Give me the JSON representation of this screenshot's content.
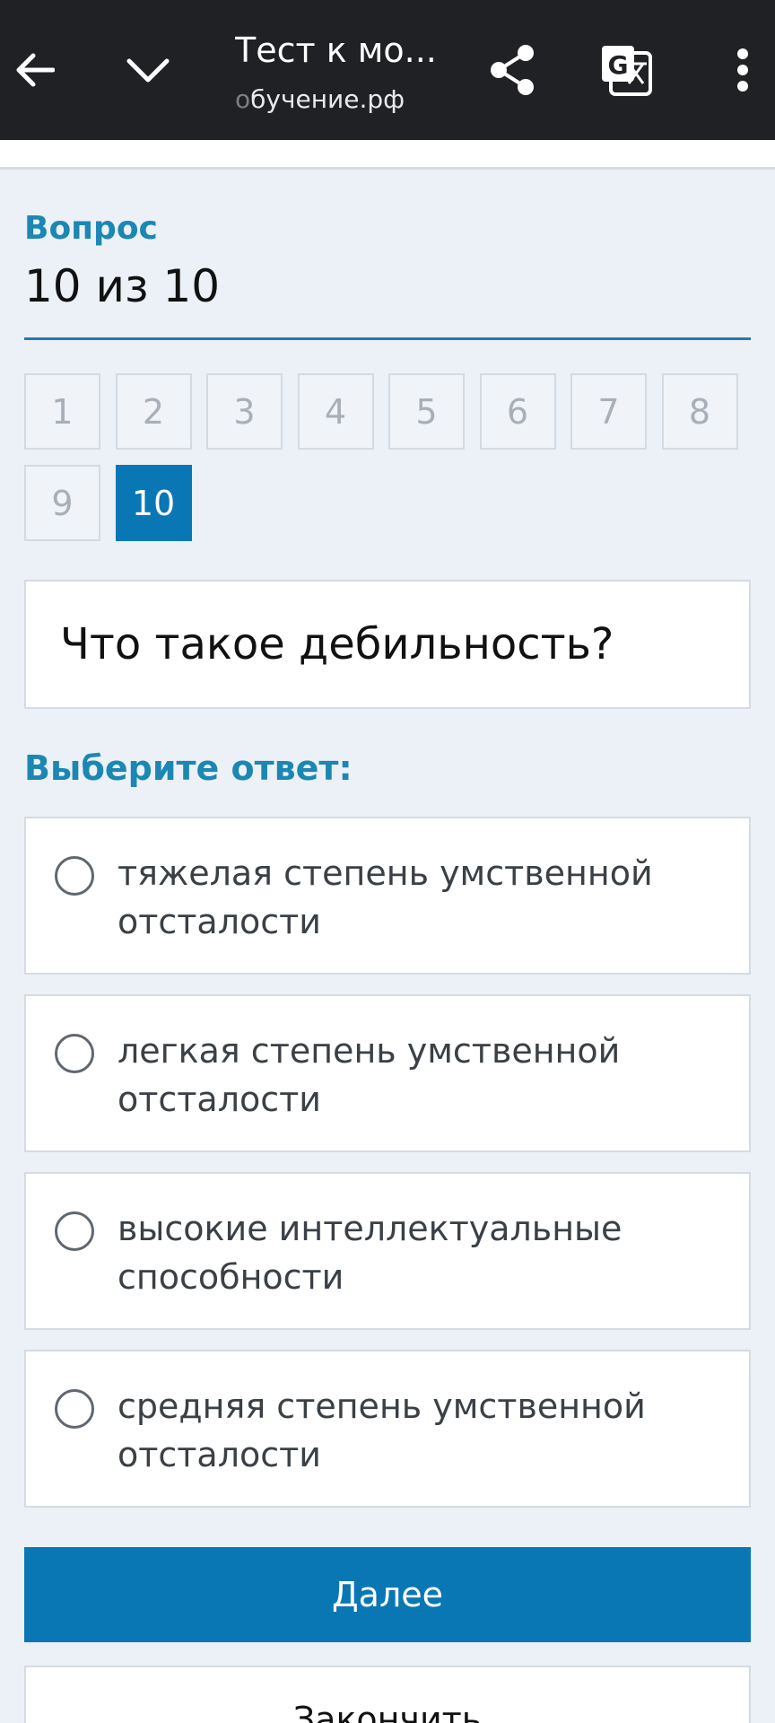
{
  "browser": {
    "title": "Тест к мо...",
    "url_fade": "о",
    "url": "бучение.рф"
  },
  "quiz": {
    "question_label": "Вопрос",
    "question_count": "10 из 10",
    "nav": [
      "1",
      "2",
      "3",
      "4",
      "5",
      "6",
      "7",
      "8",
      "9",
      "10"
    ],
    "active": "10",
    "question_text": "Что такое дебильность?",
    "choose_label": "Выберите ответ:",
    "answers": [
      "тяжелая степень умственной отсталости",
      "легкая степень умственной отсталости",
      "высокие интеллектуальные способности",
      "средняя степень умственной отсталости"
    ],
    "next_label": "Далее",
    "finish_label": "Закончить"
  },
  "colors": {
    "accent": "#0977b3",
    "label": "#1c87b2",
    "toolbar": "#202124",
    "background": "#ecf1f7"
  },
  "icons": {
    "back": "arrow-left-icon",
    "collapse": "chevron-down-icon",
    "share": "share-icon",
    "translate": "google-translate-icon",
    "menu": "more-vertical-icon"
  }
}
